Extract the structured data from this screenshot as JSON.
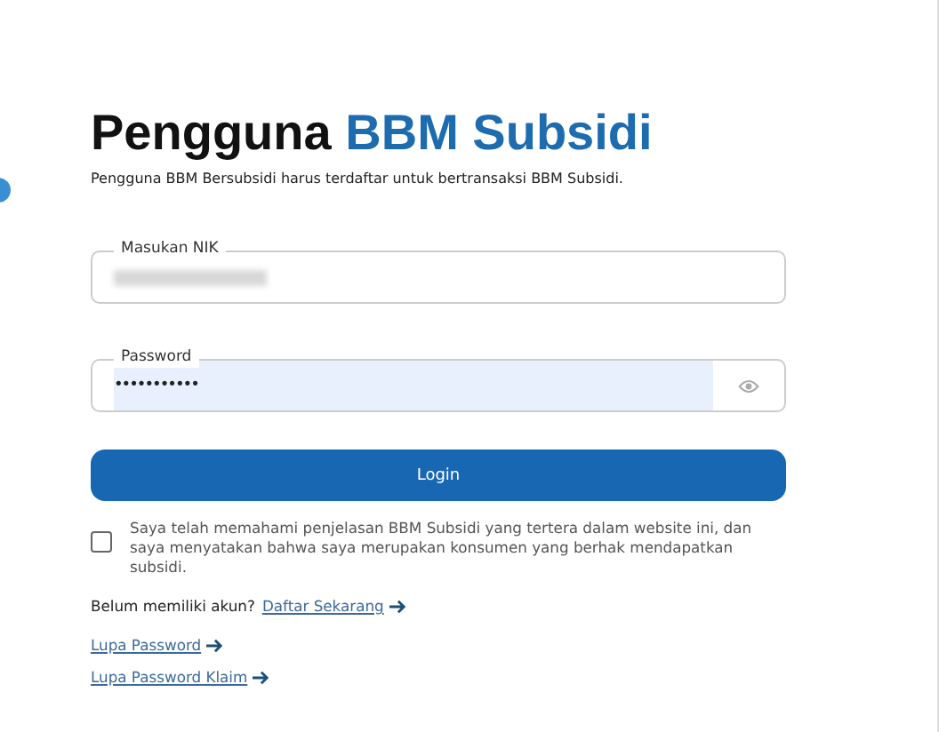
{
  "heading": {
    "text": "Pengguna",
    "highlight": "BBM Subsidi"
  },
  "subtitle": "Pengguna BBM Bersubsidi harus terdaftar untuk bertransaksi BBM Subsidi.",
  "fields": [
    {
      "kind": "text",
      "label": "Masukan NIK",
      "redacted": true
    },
    {
      "kind": "password",
      "label": "Password",
      "value": "•••••••••••"
    }
  ],
  "login_button": "Login",
  "agreement": {
    "checked": false,
    "text": "Saya telah memahami penjelasan BBM Subsidi yang tertera dalam website ini, dan saya menyatakan bahwa saya merupakan konsumen yang berhak mendapatkan subsidi."
  },
  "register": {
    "prompt": "Belum memiliki akun?",
    "link": "Daftar Sekarang"
  },
  "links": [
    "Lupa Password",
    "Lupa Password Klaim"
  ]
}
